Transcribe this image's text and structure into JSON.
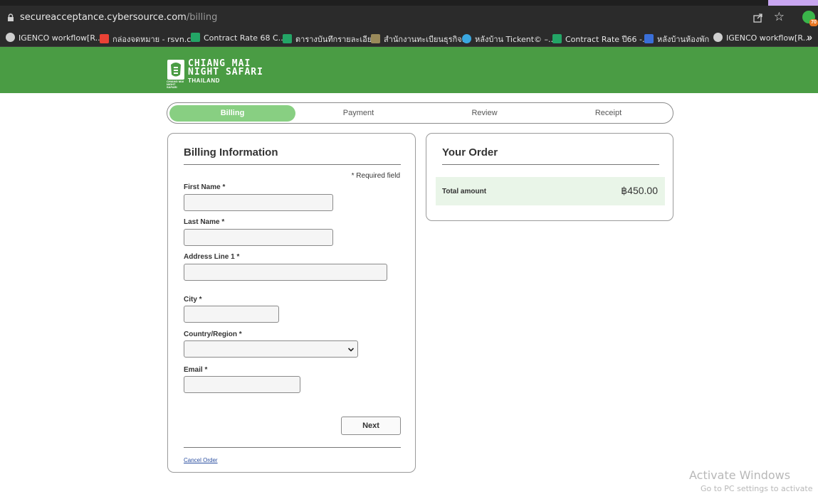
{
  "browser": {
    "url_host": "secureacceptance.cybersource.com",
    "url_path": "/billing",
    "extension_badge": "70",
    "bookmarks": [
      {
        "label": "IGENCO workflow[R...",
        "icon": "globe-icon",
        "color": "#cfcfcf"
      },
      {
        "label": "กล่องจดหมาย - rsvn.c...",
        "icon": "gmail-icon",
        "color": "#e94235"
      },
      {
        "label": "Contract Rate 68 C...",
        "icon": "sheets-icon",
        "color": "#23a566"
      },
      {
        "label": "ตารางบันทึกรายละเอีย...",
        "icon": "sheets-icon",
        "color": "#23a566"
      },
      {
        "label": "สำนักงานทะเบียนธุรกิจ...",
        "icon": "site-icon",
        "color": "#9a8a5a"
      },
      {
        "label": "หลังบ้าน Tickent© –...",
        "icon": "site-icon",
        "color": "#3aa7e0"
      },
      {
        "label": "Contract Rate ปี66 -...",
        "icon": "sheets-icon",
        "color": "#23a566"
      },
      {
        "label": "หลังบ้านห้องพัก",
        "icon": "site-icon",
        "color": "#3a6fd8"
      },
      {
        "label": "IGENCO workflow[R...",
        "icon": "globe-icon",
        "color": "#cfcfcf"
      }
    ]
  },
  "header": {
    "logo_line1": "CHIANG MAI",
    "logo_line2": "NIGHT SAFARI",
    "logo_line3": "THAILAND",
    "logo_small": "CHIANG MAI NIGHT SAFARI",
    "bg_color": "#4a9c44"
  },
  "steps": [
    {
      "label": "Billing",
      "active": true
    },
    {
      "label": "Payment",
      "active": false
    },
    {
      "label": "Review",
      "active": false
    },
    {
      "label": "Receipt",
      "active": false
    }
  ],
  "billing": {
    "title": "Billing Information",
    "required_note": "* Required field",
    "first_name_label": "First Name *",
    "first_name_value": "",
    "last_name_label": "Last Name *",
    "last_name_value": "",
    "address_label": "Address Line 1 *",
    "address_value": "",
    "city_label": "City *",
    "city_value": "",
    "country_label": "Country/Region *",
    "country_value": "",
    "email_label": "Email *",
    "email_value": "",
    "next_label": "Next",
    "cancel_label": "Cancel Order"
  },
  "order": {
    "title": "Your Order",
    "total_label": "Total amount",
    "total_value": "฿450.00"
  },
  "watermark": {
    "line1": "Activate Windows",
    "line2": "Go to PC settings to activate"
  }
}
